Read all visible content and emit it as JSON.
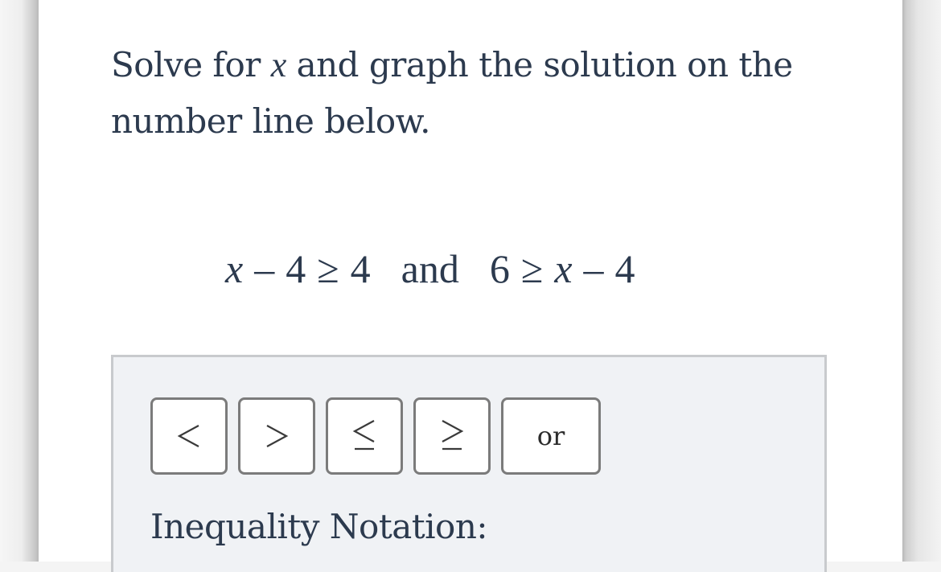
{
  "question": {
    "prefix": "Solve for",
    "variable": "x",
    "suffix_line1": "and graph the solution on the",
    "line2": "number line below."
  },
  "equation": {
    "left": {
      "var": "x",
      "minus": "–",
      "const": "4",
      "op": "≥",
      "rhs": "4"
    },
    "connector": "and",
    "right": {
      "lhs": "6",
      "op": "≥",
      "var": "x",
      "minus": "–",
      "const": "4"
    }
  },
  "answer_panel": {
    "buttons": [
      {
        "id": "less-than",
        "label": "<",
        "icon": "less-than-icon"
      },
      {
        "id": "greater-than",
        "label": ">",
        "icon": "greater-than-icon"
      },
      {
        "id": "less-equal",
        "label": "≤",
        "icon": "less-than-or-equal-icon"
      },
      {
        "id": "greater-equal",
        "label": "≥",
        "icon": "greater-than-or-equal-icon"
      },
      {
        "id": "or",
        "label": "or"
      }
    ],
    "notation_label": "Inequality Notation:"
  },
  "colors": {
    "text": "#2c3a4e",
    "panel_bg": "#f0f2f5",
    "panel_border": "#c8cacd",
    "button_border": "#7b7b7b"
  }
}
